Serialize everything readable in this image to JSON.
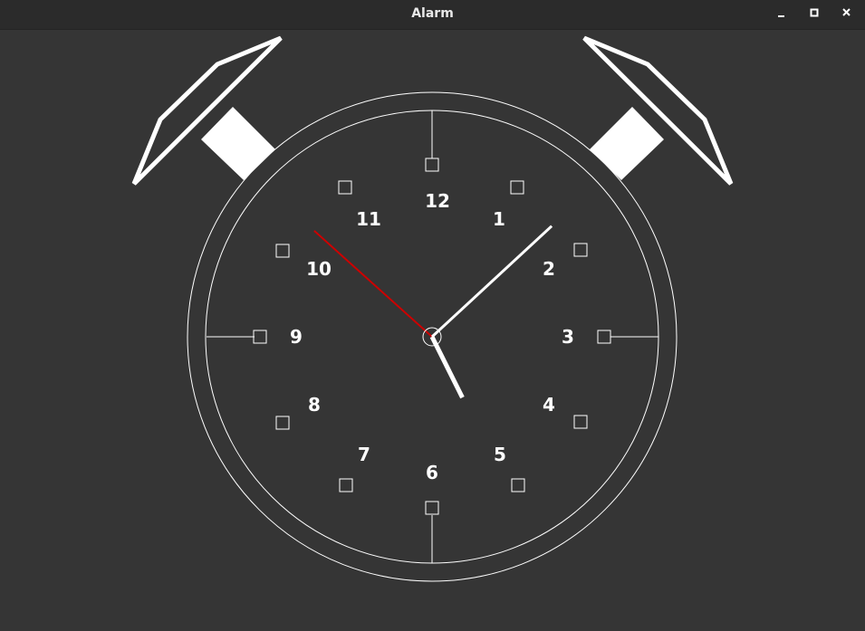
{
  "window": {
    "title": "Alarm",
    "controls": {
      "minimize": "minimize-icon",
      "maximize": "maximize-icon",
      "close": "close-icon"
    }
  },
  "clock": {
    "numerals": [
      "12",
      "1",
      "2",
      "3",
      "4",
      "5",
      "6",
      "7",
      "8",
      "9",
      "10",
      "11"
    ],
    "time": {
      "hours": 5,
      "minutes": 7,
      "seconds": 52
    },
    "colors": {
      "background": "#353535",
      "face_lines": "#ffffff",
      "second_hand": "#cc0000"
    }
  }
}
